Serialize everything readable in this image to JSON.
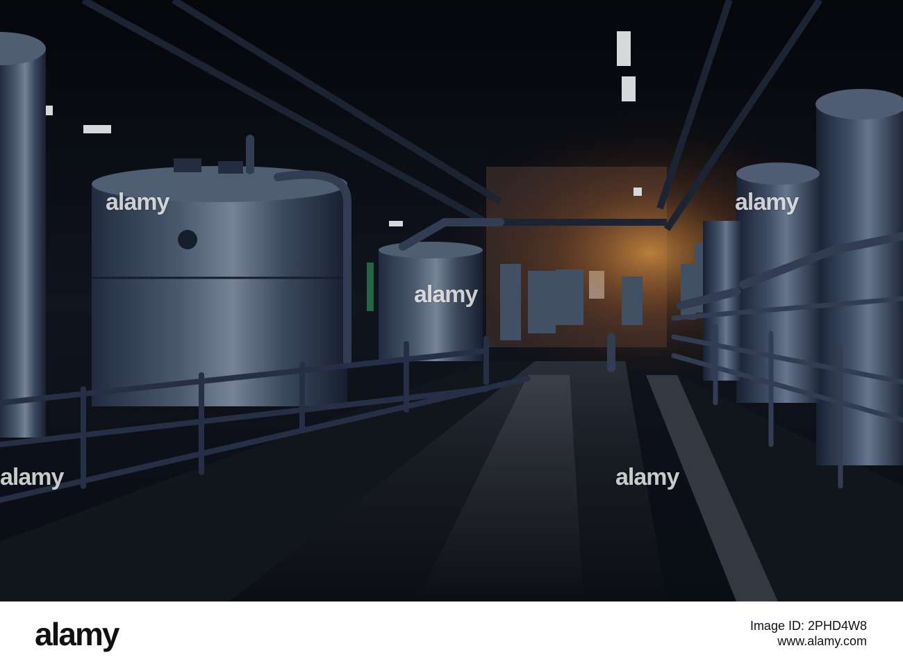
{
  "watermark": {
    "text": "alamy"
  },
  "footer": {
    "logo": "alamy",
    "image_id_line": "Image ID: 2PHD4W8",
    "site_line": "www.alamy.com"
  },
  "colors": {
    "background_dark": "#0a0e16",
    "tank_blue": "#3d4c66",
    "warm_light": "#e08a2c",
    "ceiling_light": "#f4f7fb"
  }
}
